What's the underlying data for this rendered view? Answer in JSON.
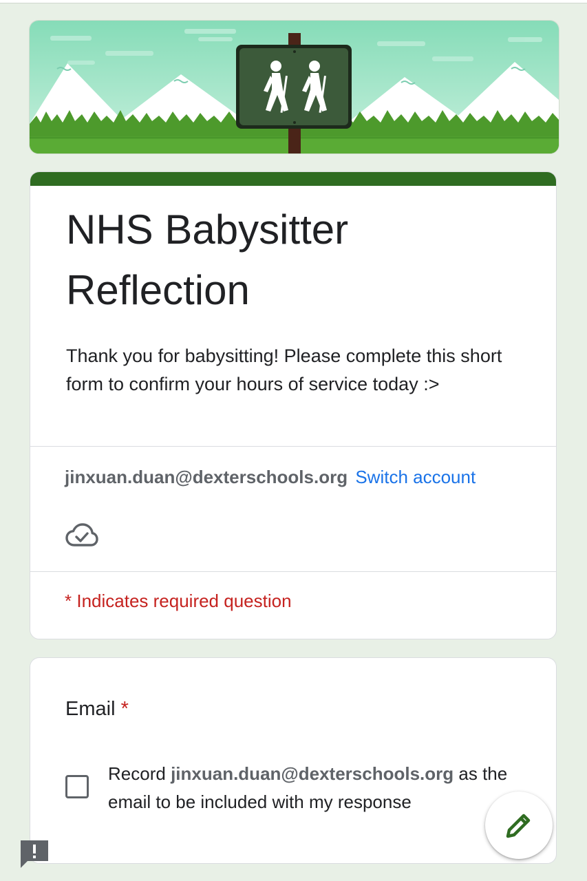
{
  "form": {
    "title": "NHS Babysitter Reflection",
    "description": "Thank you for babysitting! Please complete this short form to confirm your hours of service today :>",
    "accent_color": "#2f6c21",
    "account": {
      "email": "jinxuan.duan@dexterschools.org",
      "switch_label": "Switch account"
    },
    "cloud_icon": "cloud-saved-icon",
    "required_note": "* Indicates required question"
  },
  "questions": [
    {
      "label": "Email",
      "required_mark": "*",
      "checkbox": {
        "checked": false,
        "text_before": "Record",
        "email": "jinxuan.duan@dexterschools.org",
        "text_after": "as the email to be included with my response"
      }
    }
  ],
  "fab_icon": "pencil-icon",
  "feedback_icon": "report-feedback-icon"
}
